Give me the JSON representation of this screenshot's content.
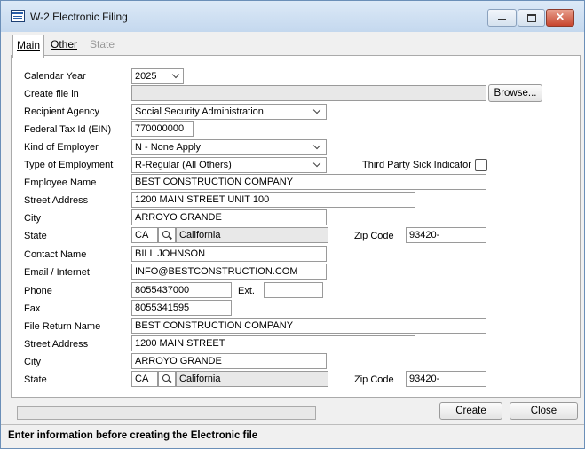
{
  "window": {
    "title": "W-2 Electronic Filing"
  },
  "tabs": {
    "main": "Main",
    "other": "Other",
    "state": "State"
  },
  "labels": {
    "calendar_year": "Calendar Year",
    "create_file_in": "Create file in",
    "recipient_agency": "Recipient Agency",
    "federal_tax_id": "Federal Tax Id (EIN)",
    "kind_of_employer": "Kind of Employer",
    "type_of_employment": "Type of Employment",
    "third_party_sick": "Third Party Sick Indicator",
    "employee_name": "Employee Name",
    "street_address": "Street Address",
    "city": "City",
    "state": "State",
    "zip_code": "Zip Code",
    "contact_name": "Contact Name",
    "email_internet": "Email / Internet",
    "phone": "Phone",
    "ext": "Ext.",
    "fax": "Fax",
    "file_return_name": "File Return Name"
  },
  "fields": {
    "calendar_year": "2025",
    "create_file_in": "",
    "recipient_agency": "Social Security Administration",
    "federal_tax_id": "770000000",
    "kind_of_employer": "N - None Apply",
    "type_of_employment": "R-Regular (All Others)",
    "employee_name": "BEST CONSTRUCTION COMPANY",
    "street_address": "1200 MAIN STREET UNIT 100",
    "city": "ARROYO GRANDE",
    "state_code": "CA",
    "state_name": "California",
    "zip_code": "93420-",
    "contact_name": "BILL JOHNSON",
    "email": "INFO@BESTCONSTRUCTION.COM",
    "phone": "8055437000",
    "ext": "",
    "fax": "8055341595",
    "return_name": "BEST CONSTRUCTION COMPANY",
    "return_street": "1200 MAIN STREET",
    "return_city": "ARROYO GRANDE",
    "return_state_code": "CA",
    "return_state_name": "California",
    "return_zip": "93420-"
  },
  "buttons": {
    "browse": "Browse...",
    "create": "Create",
    "close": "Close"
  },
  "status": {
    "message": "Enter information before creating the Electronic file"
  }
}
